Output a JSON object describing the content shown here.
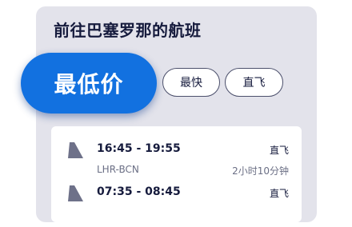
{
  "header": {
    "title": "前往巴塞罗那的航班"
  },
  "filters": {
    "active_label": "最低价",
    "options": [
      "最快",
      "直飞"
    ]
  },
  "flights": [
    {
      "times": "16:45 - 19:55",
      "route": "LHR-BCN",
      "stops": "直飞",
      "duration": "2小时10分钟",
      "icon": "airline-tail-icon"
    },
    {
      "times": "07:35 - 08:45",
      "route": "",
      "stops": "直飞",
      "duration": "",
      "icon": "airline-tail-icon"
    }
  ],
  "colors": {
    "accent": "#1271e0",
    "card_bg": "#e3e3eb",
    "text_dark": "#161b3d",
    "text_muted": "#6b6f85"
  }
}
